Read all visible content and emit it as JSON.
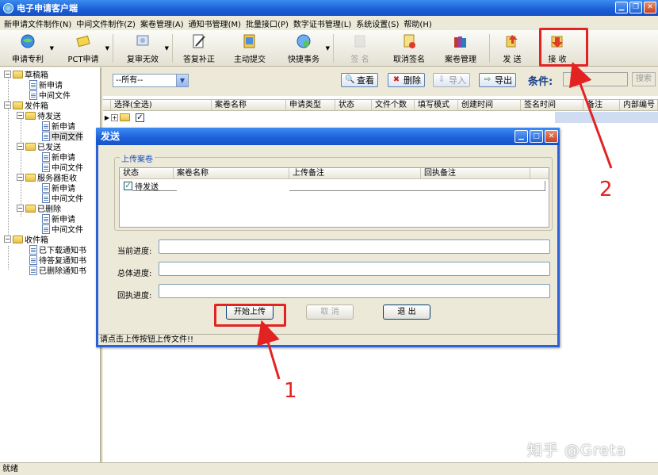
{
  "window": {
    "title": "电子申请客户端"
  },
  "menu": [
    "新申请文件制作(N)",
    "中间文件制作(Z)",
    "案卷管理(A)",
    "通知书管理(M)",
    "批量接口(P)",
    "数字证书管理(L)",
    "系统设置(S)",
    "帮助(H)"
  ],
  "toolbar": {
    "apply_patent": "申请专利",
    "pct_apply": "PCT申请",
    "review_invalid": "复审无效",
    "reply_correction": "答复补正",
    "active_submit": "主动提交",
    "quick_affairs": "快捷事务",
    "sign": "签 名",
    "cancel_sign": "取消签名",
    "case_manage": "案卷管理",
    "send": "发 送",
    "receive": "接 收"
  },
  "tree": {
    "draft_box": "草稿箱",
    "draft_new": "新申请",
    "draft_middle": "中间文件",
    "outbox": "发件箱",
    "pending_send": "待发送",
    "pending_new": "新申请",
    "pending_middle": "中间文件",
    "sent": "已发送",
    "sent_new": "新申请",
    "sent_middle": "中间文件",
    "server_reject": "服务器拒收",
    "reject_new": "新申请",
    "reject_middle": "中间文件",
    "deleted": "已删除",
    "deleted_new": "新申请",
    "deleted_middle": "中间文件",
    "inbox": "收件箱",
    "downloaded_notice": "已下载通知书",
    "pending_reply_notice": "待答复通知书",
    "deleted_notice": "已删除通知书"
  },
  "filter": {
    "select_value": "--所有--",
    "view": "查看",
    "delete": "删除",
    "import": "导入",
    "export": "导出",
    "condition": "条件:",
    "search": "搜索"
  },
  "grid_columns": [
    "选择(全选)",
    "案卷名称",
    "申请类型",
    "状态",
    "文件个数",
    "填写模式",
    "创建时间",
    "签名时间",
    "备注",
    "内部编号"
  ],
  "dialog": {
    "title": "发送",
    "group_title": "上传案卷",
    "list_columns": [
      "状态",
      "案卷名称",
      "上传备注",
      "回执备注"
    ],
    "row_status": "待发送",
    "current_progress": "当前进度:",
    "total_progress": "总体进度:",
    "receipt_progress": "回执进度:",
    "start_upload": "开始上传",
    "cancel": "取 消",
    "exit": "退 出",
    "status_text": "请点击上传按钮上传文件!!"
  },
  "status_bar": "就绪",
  "annotations": {
    "one": "1",
    "two": "2"
  },
  "watermark": "知乎 @Greta",
  "colors": {
    "title_blue": "#1a5fd6",
    "annotation_red": "#e32222"
  }
}
